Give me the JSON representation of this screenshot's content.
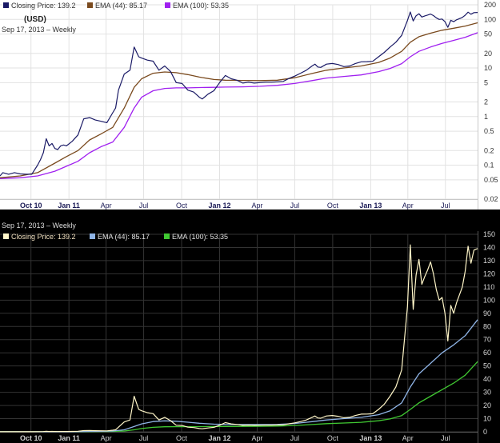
{
  "chart_data": [
    {
      "type": "line",
      "scale": "log",
      "theme": "light",
      "subtitle": "(USD)",
      "date_label": "Sep 17, 2013 – Weekly",
      "legend": [
        {
          "label": "Closing Price: 139.2",
          "color": "#1a1a66",
          "series": "close"
        },
        {
          "label": "EMA (44): 85.17",
          "color": "#7a4a1e",
          "series": "ema44"
        },
        {
          "label": "EMA (100): 53.35",
          "color": "#a020f0",
          "series": "ema100"
        }
      ],
      "ylim": [
        0.02,
        200
      ],
      "yticks": [
        {
          "v": 200,
          "label": "200"
        },
        {
          "v": 100,
          "label": "100"
        },
        {
          "v": 50,
          "label": "50"
        },
        {
          "v": 20,
          "label": "20"
        },
        {
          "v": 10,
          "label": "10"
        },
        {
          "v": 5,
          "label": "5"
        },
        {
          "v": 2,
          "label": "2"
        },
        {
          "v": 1,
          "label": "1"
        },
        {
          "v": 0.5,
          "label": "0.5"
        },
        {
          "v": 0.2,
          "label": "0.2"
        },
        {
          "v": 0.1,
          "label": "0.1"
        },
        {
          "v": 0.05,
          "label": "0.05"
        },
        {
          "v": 0.02,
          "label": "0.02"
        }
      ]
    },
    {
      "type": "line",
      "scale": "linear",
      "theme": "dark",
      "date_label": "Sep 17, 2013 – Weekly",
      "legend": [
        {
          "label": "Closing Price: 139.2",
          "color": "#fff6c8",
          "series": "close"
        },
        {
          "label": "EMA (44): 85.17",
          "color": "#8fb4e6",
          "series": "ema44"
        },
        {
          "label": "EMA (100): 53.35",
          "color": "#40c832",
          "series": "ema100"
        }
      ],
      "ylim": [
        0,
        150
      ],
      "yticks": [
        {
          "v": 150,
          "label": "150"
        },
        {
          "v": 140,
          "label": "140"
        },
        {
          "v": 130,
          "label": "130"
        },
        {
          "v": 120,
          "label": "120"
        },
        {
          "v": 110,
          "label": "110"
        },
        {
          "v": 100,
          "label": "100"
        },
        {
          "v": 90,
          "label": "90"
        },
        {
          "v": 80,
          "label": "80"
        },
        {
          "v": 70,
          "label": "70"
        },
        {
          "v": 60,
          "label": "60"
        },
        {
          "v": 50,
          "label": "50"
        },
        {
          "v": 40,
          "label": "40"
        },
        {
          "v": 30,
          "label": "30"
        },
        {
          "v": 20,
          "label": "20"
        },
        {
          "v": 10,
          "label": "10"
        },
        {
          "v": 0,
          "label": "0"
        }
      ]
    }
  ],
  "x_axis": {
    "start": "2010-07-18",
    "end": "2013-09-17",
    "ticks": [
      {
        "date": "2010-10-01",
        "label": "Oct 10",
        "bold": true
      },
      {
        "date": "2011-01-01",
        "label": "Jan 11",
        "bold": true
      },
      {
        "date": "2011-04-01",
        "label": "Apr",
        "bold": false
      },
      {
        "date": "2011-07-01",
        "label": "Jul",
        "bold": false
      },
      {
        "date": "2011-10-01",
        "label": "Oct",
        "bold": false
      },
      {
        "date": "2012-01-01",
        "label": "Jan 12",
        "bold": true
      },
      {
        "date": "2012-04-01",
        "label": "Apr",
        "bold": false
      },
      {
        "date": "2012-07-01",
        "label": "Jul",
        "bold": false
      },
      {
        "date": "2012-10-01",
        "label": "Oct",
        "bold": false
      },
      {
        "date": "2013-01-01",
        "label": "Jan 13",
        "bold": true
      },
      {
        "date": "2013-04-01",
        "label": "Apr",
        "bold": false
      },
      {
        "date": "2013-07-01",
        "label": "Jul",
        "bold": false
      }
    ]
  },
  "series": {
    "close": [
      [
        "2010-07-18",
        0.06
      ],
      [
        "2010-07-25",
        0.07
      ],
      [
        "2010-08-08",
        0.065
      ],
      [
        "2010-08-22",
        0.07
      ],
      [
        "2010-09-05",
        0.066
      ],
      [
        "2010-09-19",
        0.065
      ],
      [
        "2010-10-03",
        0.065
      ],
      [
        "2010-10-17",
        0.1
      ],
      [
        "2010-10-24",
        0.13
      ],
      [
        "2010-10-31",
        0.18
      ],
      [
        "2010-11-07",
        0.35
      ],
      [
        "2010-11-14",
        0.25
      ],
      [
        "2010-11-21",
        0.28
      ],
      [
        "2010-11-28",
        0.22
      ],
      [
        "2010-12-05",
        0.21
      ],
      [
        "2010-12-12",
        0.25
      ],
      [
        "2010-12-19",
        0.26
      ],
      [
        "2010-12-26",
        0.25
      ],
      [
        "2011-01-09",
        0.31
      ],
      [
        "2011-01-23",
        0.42
      ],
      [
        "2011-02-06",
        0.9
      ],
      [
        "2011-02-20",
        0.95
      ],
      [
        "2011-03-06",
        0.85
      ],
      [
        "2011-03-20",
        0.8
      ],
      [
        "2011-04-03",
        0.75
      ],
      [
        "2011-04-17",
        1.2
      ],
      [
        "2011-04-24",
        1.5
      ],
      [
        "2011-05-01",
        3.5
      ],
      [
        "2011-05-15",
        7.5
      ],
      [
        "2011-05-29",
        9
      ],
      [
        "2011-06-08",
        27
      ],
      [
        "2011-06-19",
        17
      ],
      [
        "2011-06-26",
        16
      ],
      [
        "2011-07-10",
        14.5
      ],
      [
        "2011-07-24",
        13.8
      ],
      [
        "2011-08-07",
        9
      ],
      [
        "2011-08-21",
        11
      ],
      [
        "2011-09-04",
        8.5
      ],
      [
        "2011-09-18",
        5
      ],
      [
        "2011-10-02",
        4.8
      ],
      [
        "2011-10-16",
        3.5
      ],
      [
        "2011-10-30",
        3.2
      ],
      [
        "2011-11-13",
        2.5
      ],
      [
        "2011-11-20",
        2.3
      ],
      [
        "2011-12-04",
        2.9
      ],
      [
        "2011-12-18",
        3.4
      ],
      [
        "2012-01-01",
        5
      ],
      [
        "2012-01-15",
        7
      ],
      [
        "2012-01-29",
        6
      ],
      [
        "2012-02-12",
        5.6
      ],
      [
        "2012-02-26",
        4.9
      ],
      [
        "2012-03-11",
        5.1
      ],
      [
        "2012-03-25",
        4.9
      ],
      [
        "2012-04-08",
        5
      ],
      [
        "2012-04-22",
        5.1
      ],
      [
        "2012-05-06",
        5.1
      ],
      [
        "2012-05-20",
        5.2
      ],
      [
        "2012-06-03",
        5.3
      ],
      [
        "2012-06-17",
        6.1
      ],
      [
        "2012-07-01",
        6.8
      ],
      [
        "2012-07-15",
        7.8
      ],
      [
        "2012-07-29",
        9
      ],
      [
        "2012-08-12",
        11
      ],
      [
        "2012-08-19",
        12
      ],
      [
        "2012-08-26",
        10.5
      ],
      [
        "2012-09-02",
        10.3
      ],
      [
        "2012-09-16",
        12
      ],
      [
        "2012-09-30",
        12.4
      ],
      [
        "2012-10-14",
        11.8
      ],
      [
        "2012-10-28",
        10.7
      ],
      [
        "2012-11-11",
        11
      ],
      [
        "2012-11-25",
        12.4
      ],
      [
        "2012-12-09",
        13.4
      ],
      [
        "2012-12-23",
        13.5
      ],
      [
        "2013-01-06",
        13.7
      ],
      [
        "2013-01-20",
        17
      ],
      [
        "2013-02-03",
        21
      ],
      [
        "2013-02-17",
        27
      ],
      [
        "2013-03-03",
        34
      ],
      [
        "2013-03-17",
        47
      ],
      [
        "2013-03-31",
        95
      ],
      [
        "2013-04-07",
        142
      ],
      [
        "2013-04-14",
        93
      ],
      [
        "2013-04-21",
        119
      ],
      [
        "2013-04-28",
        131
      ],
      [
        "2013-05-05",
        112
      ],
      [
        "2013-05-12",
        118
      ],
      [
        "2013-05-19",
        123
      ],
      [
        "2013-05-26",
        129
      ],
      [
        "2013-06-02",
        120
      ],
      [
        "2013-06-09",
        108
      ],
      [
        "2013-06-16",
        100
      ],
      [
        "2013-06-23",
        102
      ],
      [
        "2013-06-30",
        90
      ],
      [
        "2013-07-07",
        69
      ],
      [
        "2013-07-14",
        96
      ],
      [
        "2013-07-21",
        90
      ],
      [
        "2013-07-28",
        98
      ],
      [
        "2013-08-04",
        104
      ],
      [
        "2013-08-11",
        110
      ],
      [
        "2013-08-18",
        122
      ],
      [
        "2013-08-25",
        141
      ],
      [
        "2013-09-01",
        128
      ],
      [
        "2013-09-08",
        138
      ],
      [
        "2013-09-17",
        139.2
      ]
    ],
    "ema44": [
      [
        "2010-07-18",
        0.055
      ],
      [
        "2010-09-05",
        0.06
      ],
      [
        "2010-10-17",
        0.07
      ],
      [
        "2010-11-28",
        0.11
      ],
      [
        "2010-12-26",
        0.15
      ],
      [
        "2011-01-23",
        0.2
      ],
      [
        "2011-02-20",
        0.33
      ],
      [
        "2011-03-20",
        0.44
      ],
      [
        "2011-04-17",
        0.6
      ],
      [
        "2011-05-15",
        1.5
      ],
      [
        "2011-06-08",
        4
      ],
      [
        "2011-06-26",
        6
      ],
      [
        "2011-07-24",
        7.8
      ],
      [
        "2011-08-21",
        8.3
      ],
      [
        "2011-09-18",
        8
      ],
      [
        "2011-10-16",
        7.3
      ],
      [
        "2011-11-13",
        6.5
      ],
      [
        "2011-12-18",
        5.8
      ],
      [
        "2012-01-15",
        5.6
      ],
      [
        "2012-02-26",
        5.55
      ],
      [
        "2012-04-08",
        5.5
      ],
      [
        "2012-05-20",
        5.6
      ],
      [
        "2012-07-01",
        6.3
      ],
      [
        "2012-08-12",
        7.7
      ],
      [
        "2012-09-16",
        9
      ],
      [
        "2012-10-28",
        10
      ],
      [
        "2012-12-09",
        11
      ],
      [
        "2013-01-20",
        13
      ],
      [
        "2013-02-17",
        16
      ],
      [
        "2013-03-17",
        22
      ],
      [
        "2013-04-07",
        34
      ],
      [
        "2013-04-28",
        44
      ],
      [
        "2013-05-26",
        52
      ],
      [
        "2013-06-23",
        60
      ],
      [
        "2013-07-21",
        66
      ],
      [
        "2013-08-18",
        73
      ],
      [
        "2013-09-17",
        85.17
      ]
    ],
    "ema100": [
      [
        "2010-07-18",
        0.053
      ],
      [
        "2010-09-05",
        0.055
      ],
      [
        "2010-10-17",
        0.06
      ],
      [
        "2010-11-28",
        0.075
      ],
      [
        "2010-12-26",
        0.095
      ],
      [
        "2011-01-23",
        0.12
      ],
      [
        "2011-02-20",
        0.18
      ],
      [
        "2011-03-20",
        0.24
      ],
      [
        "2011-04-17",
        0.3
      ],
      [
        "2011-05-15",
        0.6
      ],
      [
        "2011-06-08",
        1.5
      ],
      [
        "2011-06-26",
        2.5
      ],
      [
        "2011-07-24",
        3.4
      ],
      [
        "2011-08-21",
        3.8
      ],
      [
        "2011-09-18",
        3.9
      ],
      [
        "2011-10-16",
        3.9
      ],
      [
        "2011-11-13",
        3.95
      ],
      [
        "2011-12-18",
        4
      ],
      [
        "2012-01-15",
        4.05
      ],
      [
        "2012-02-26",
        4.1
      ],
      [
        "2012-04-08",
        4.2
      ],
      [
        "2012-05-20",
        4.4
      ],
      [
        "2012-07-01",
        4.8
      ],
      [
        "2012-08-12",
        5.5
      ],
      [
        "2012-09-16",
        6.2
      ],
      [
        "2012-10-28",
        6.7
      ],
      [
        "2012-12-09",
        7.2
      ],
      [
        "2013-01-20",
        8.4
      ],
      [
        "2013-02-17",
        9.8
      ],
      [
        "2013-03-17",
        12.3
      ],
      [
        "2013-04-07",
        17
      ],
      [
        "2013-04-28",
        22
      ],
      [
        "2013-05-26",
        27
      ],
      [
        "2013-06-23",
        32
      ],
      [
        "2013-07-21",
        37
      ],
      [
        "2013-08-18",
        43
      ],
      [
        "2013-09-17",
        53.35
      ]
    ]
  }
}
